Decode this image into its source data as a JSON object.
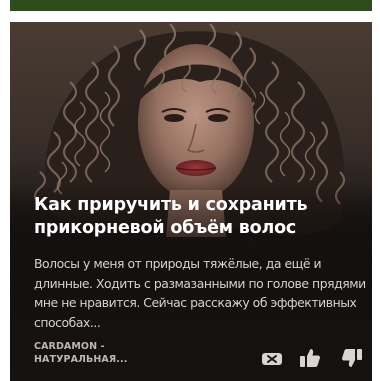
{
  "top_strip": {
    "color": "#2f4d1c"
  },
  "card": {
    "title": "Как приручить и сохранить прикорневой объём волос",
    "description": "Волосы у меня от природы тяжёлые, да ещё и длинные. Ходить с размазанными по голове прядями мне не нравится. Сейчас расскажу об эффективных способах...",
    "source": "CARDAMON - НАТУРАЛЬНАЯ...",
    "image": "woman-curly-hair-photo",
    "background": "#1b1716",
    "text_color": "#ffffff"
  },
  "actions": {
    "hide_icon": "hide-publication-icon",
    "like_icon": "thumbs-up-icon",
    "dislike_icon": "thumbs-down-icon"
  }
}
